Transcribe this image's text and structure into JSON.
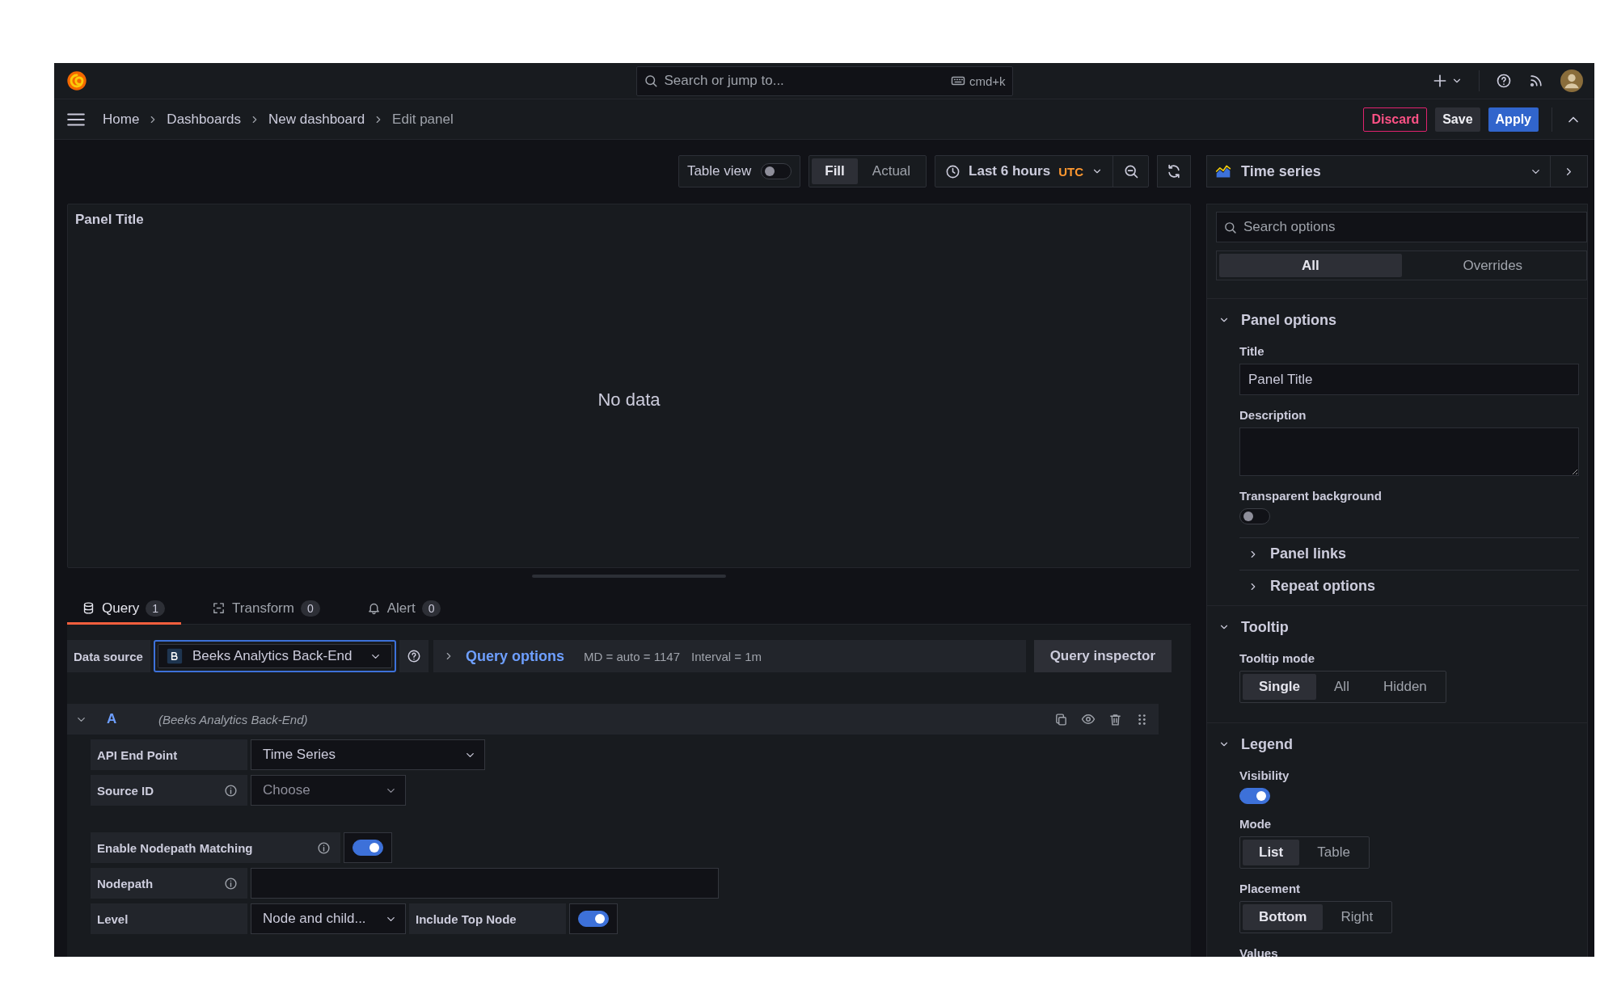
{
  "topbar": {
    "search_placeholder": "Search or jump to...",
    "shortcut": "cmd+k"
  },
  "breadcrumbs": [
    {
      "label": "Home",
      "current": false
    },
    {
      "label": "Dashboards",
      "current": false
    },
    {
      "label": "New dashboard",
      "current": false
    },
    {
      "label": "Edit panel",
      "current": true
    }
  ],
  "actions": [
    {
      "label": "Discard",
      "kind": "destructive"
    },
    {
      "label": "Save",
      "kind": "secondary"
    },
    {
      "label": "Apply",
      "kind": "primary"
    }
  ],
  "toolbar": {
    "table_view": {
      "label": "Table view",
      "on": false
    },
    "fill_modes": [
      {
        "label": "Fill",
        "selected": true
      },
      {
        "label": "Actual",
        "selected": false
      }
    ],
    "time_range": {
      "label": "Last 6 hours",
      "timezone": "UTC"
    }
  },
  "visualization": {
    "label": "Time series"
  },
  "panel": {
    "title": "Panel Title",
    "message": "No data"
  },
  "tabs": [
    {
      "label": "Query",
      "count": "1",
      "kind": "query",
      "selected": true
    },
    {
      "label": "Transform",
      "count": "0",
      "kind": "transform",
      "selected": false
    },
    {
      "label": "Alert",
      "count": "0",
      "kind": "alert",
      "selected": false
    }
  ],
  "data_source": {
    "label": "Data source",
    "value": "Beeks Analytics Back-End",
    "query_options": "Query options",
    "max_data_points": "MD = auto = 1147",
    "interval": "Interval = 1m",
    "inspector": "Query inspector"
  },
  "query": {
    "ref": "A",
    "source": "(Beeks Analytics Back-End)",
    "expanded": true,
    "fields": [
      {
        "kind": "select",
        "label": "API End Point",
        "info": false,
        "value": "Time Series"
      },
      {
        "kind": "select",
        "label": "Source ID",
        "info": true,
        "placeholder": "Choose"
      },
      {
        "kind": "switch",
        "label": "Enable Nodepath Matching",
        "info": true,
        "on": true
      },
      {
        "kind": "input",
        "label": "Nodepath",
        "info": true
      },
      {
        "kind": "select_switch",
        "label": "Level",
        "info": false,
        "value": "Node and child...",
        "switch_label": "Include Top Node",
        "on": true
      }
    ]
  },
  "options": {
    "search_placeholder": "Search options",
    "tabs": [
      {
        "label": "All",
        "selected": true
      },
      {
        "label": "Overrides",
        "selected": false
      }
    ],
    "sections": [
      {
        "title": "Panel options",
        "expanded": true,
        "items": [
          {
            "kind": "text",
            "label": "Title",
            "value": "Panel Title"
          },
          {
            "kind": "textarea",
            "label": "Description"
          },
          {
            "kind": "switch",
            "label": "Transparent background",
            "on": false
          },
          {
            "kind": "category",
            "label": "Panel links",
            "expanded": false
          },
          {
            "kind": "category",
            "label": "Repeat options",
            "expanded": false
          }
        ]
      },
      {
        "title": "Tooltip",
        "expanded": true,
        "items": [
          {
            "kind": "radio",
            "label": "Tooltip mode",
            "options": [
              {
                "label": "Single",
                "selected": true
              },
              {
                "label": "All",
                "selected": false
              },
              {
                "label": "Hidden",
                "selected": false
              }
            ]
          }
        ]
      },
      {
        "title": "Legend",
        "expanded": true,
        "items": [
          {
            "kind": "switch",
            "label": "Visibility",
            "on": true
          },
          {
            "kind": "radio",
            "label": "Mode",
            "options": [
              {
                "label": "List",
                "selected": true
              },
              {
                "label": "Table",
                "selected": false
              }
            ]
          },
          {
            "kind": "radio",
            "label": "Placement",
            "options": [
              {
                "label": "Bottom",
                "selected": true
              },
              {
                "label": "Right",
                "selected": false
              }
            ]
          },
          {
            "kind": "heading",
            "label": "Values"
          }
        ]
      }
    ]
  }
}
